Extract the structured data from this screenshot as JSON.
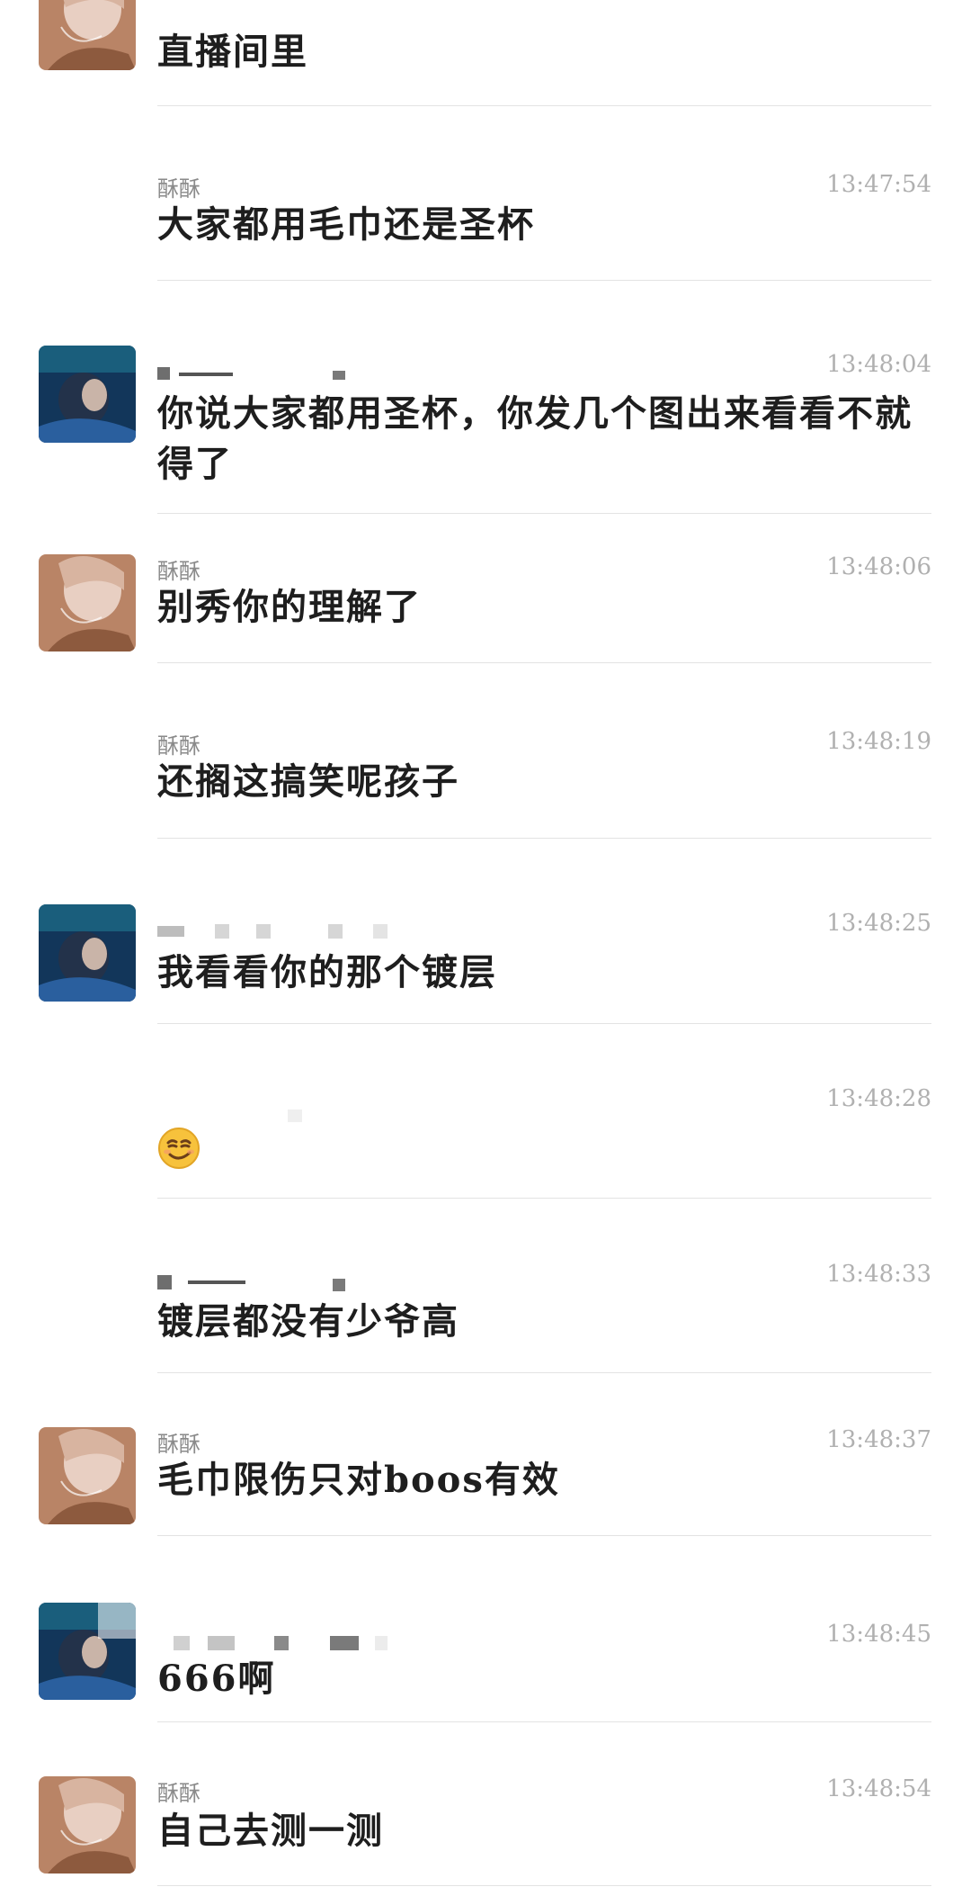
{
  "messages": [
    {
      "sender": "",
      "time": "",
      "text": "直播间里",
      "avatar": "avatar-a"
    },
    {
      "sender": "酥酥",
      "time": "13:47:54",
      "text": "大家都用毛巾还是圣杯",
      "avatar": ""
    },
    {
      "sender": "",
      "time": "13:48:04",
      "text": "你说大家都用圣杯，你发几个图出来看看不就得了",
      "avatar": "avatar-b"
    },
    {
      "sender": "酥酥",
      "time": "13:48:06",
      "text": "别秀你的理解了",
      "avatar": "avatar-a"
    },
    {
      "sender": "酥酥",
      "time": "13:48:19",
      "text": "还搁这搞笑呢孩子",
      "avatar": ""
    },
    {
      "sender": "",
      "time": "13:48:25",
      "text": "我看看你的那个镀层",
      "avatar": "avatar-b"
    },
    {
      "sender": "",
      "time": "13:48:28",
      "text": "",
      "emoji": "smirk-emoji",
      "avatar": ""
    },
    {
      "sender": "",
      "time": "13:48:33",
      "text": "镀层都没有少爷高",
      "avatar": ""
    },
    {
      "sender": "酥酥",
      "time": "13:48:37",
      "text": "毛巾限伤只对boos有效",
      "avatar": "avatar-a"
    },
    {
      "sender": "",
      "time": "13:48:45",
      "text": "666啊",
      "avatar": "avatar-b"
    },
    {
      "sender": "酥酥",
      "time": "13:48:54",
      "text": "自己去测一测",
      "avatar": "avatar-a"
    }
  ]
}
